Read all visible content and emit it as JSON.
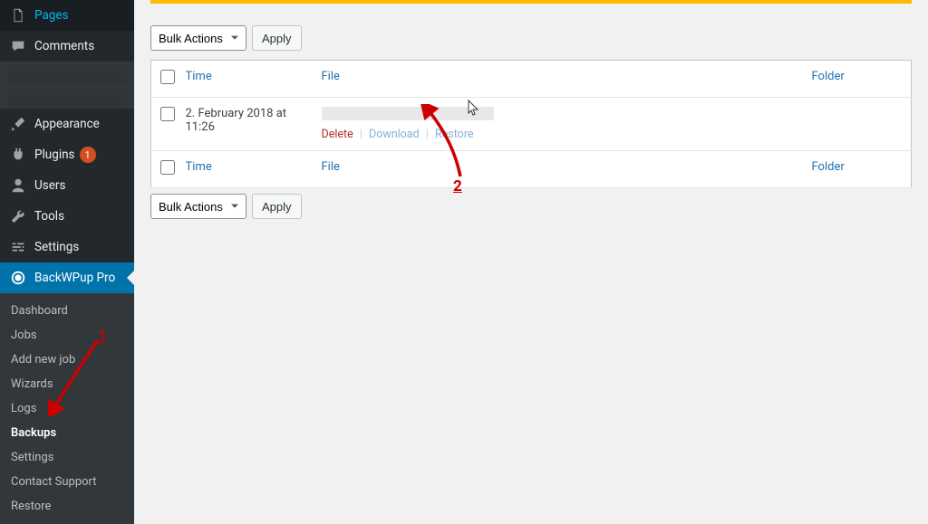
{
  "sidebar": {
    "primary": [
      {
        "label": "Pages",
        "icon": "pages"
      },
      {
        "label": "Comments",
        "icon": "comment"
      }
    ],
    "secondary": [
      {
        "label": "Appearance",
        "icon": "brush"
      },
      {
        "label": "Plugins",
        "icon": "plug",
        "badge": "1"
      },
      {
        "label": "Users",
        "icon": "user"
      },
      {
        "label": "Tools",
        "icon": "wrench"
      },
      {
        "label": "Settings",
        "icon": "sliders"
      }
    ],
    "active": {
      "label": "BackWPup Pro",
      "icon": "backwpup"
    },
    "submenu": [
      "Dashboard",
      "Jobs",
      "Add new job",
      "Wizards",
      "Logs",
      "Backups",
      "Settings",
      "Contact Support",
      "Restore"
    ]
  },
  "bulk": {
    "label": "Bulk Actions",
    "apply": "Apply"
  },
  "table": {
    "headers": {
      "time": "Time",
      "file": "File",
      "folder": "Folder"
    },
    "rows": [
      {
        "time": "2. February 2018 at 11:26"
      }
    ],
    "actions": {
      "delete": "Delete",
      "download": "Download",
      "restore": "Restore"
    }
  },
  "annotation": {
    "one": "1",
    "two": "2"
  }
}
